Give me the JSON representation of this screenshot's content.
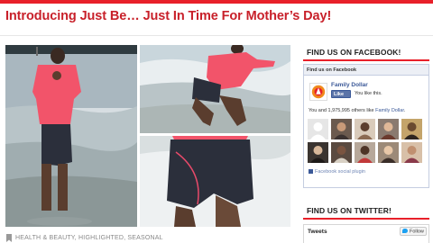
{
  "post": {
    "title": "Introducing Just Be… Just In Time For Mother’s Day!",
    "categories": "HEALTH & BEAUTY, HIGHLIGHTED, SEASONAL"
  },
  "gallery": {
    "photos": [
      "beach-photo-back-view",
      "beach-photo-jumping",
      "beach-photo-shorts-closeup"
    ]
  },
  "sidebar": {
    "facebook": {
      "section_title": "FIND US ON FACEBOOK!",
      "box_header": "Find us on Facebook",
      "page_name": "Family Dollar",
      "like_button": "Like",
      "liked_text": "You like this.",
      "count_prefix": "You and 1,975,995 others like ",
      "count_link": "Family Dollar",
      "count_suffix": ".",
      "plugin_label": "Facebook social plugin"
    },
    "twitter": {
      "section_title": "FIND US ON TWITTER!",
      "tweets_label": "Tweets",
      "follow_button": "Follow"
    }
  },
  "colors": {
    "accent": "#e8202a",
    "title": "#c8202a",
    "facebook_blue": "#3b5998"
  }
}
